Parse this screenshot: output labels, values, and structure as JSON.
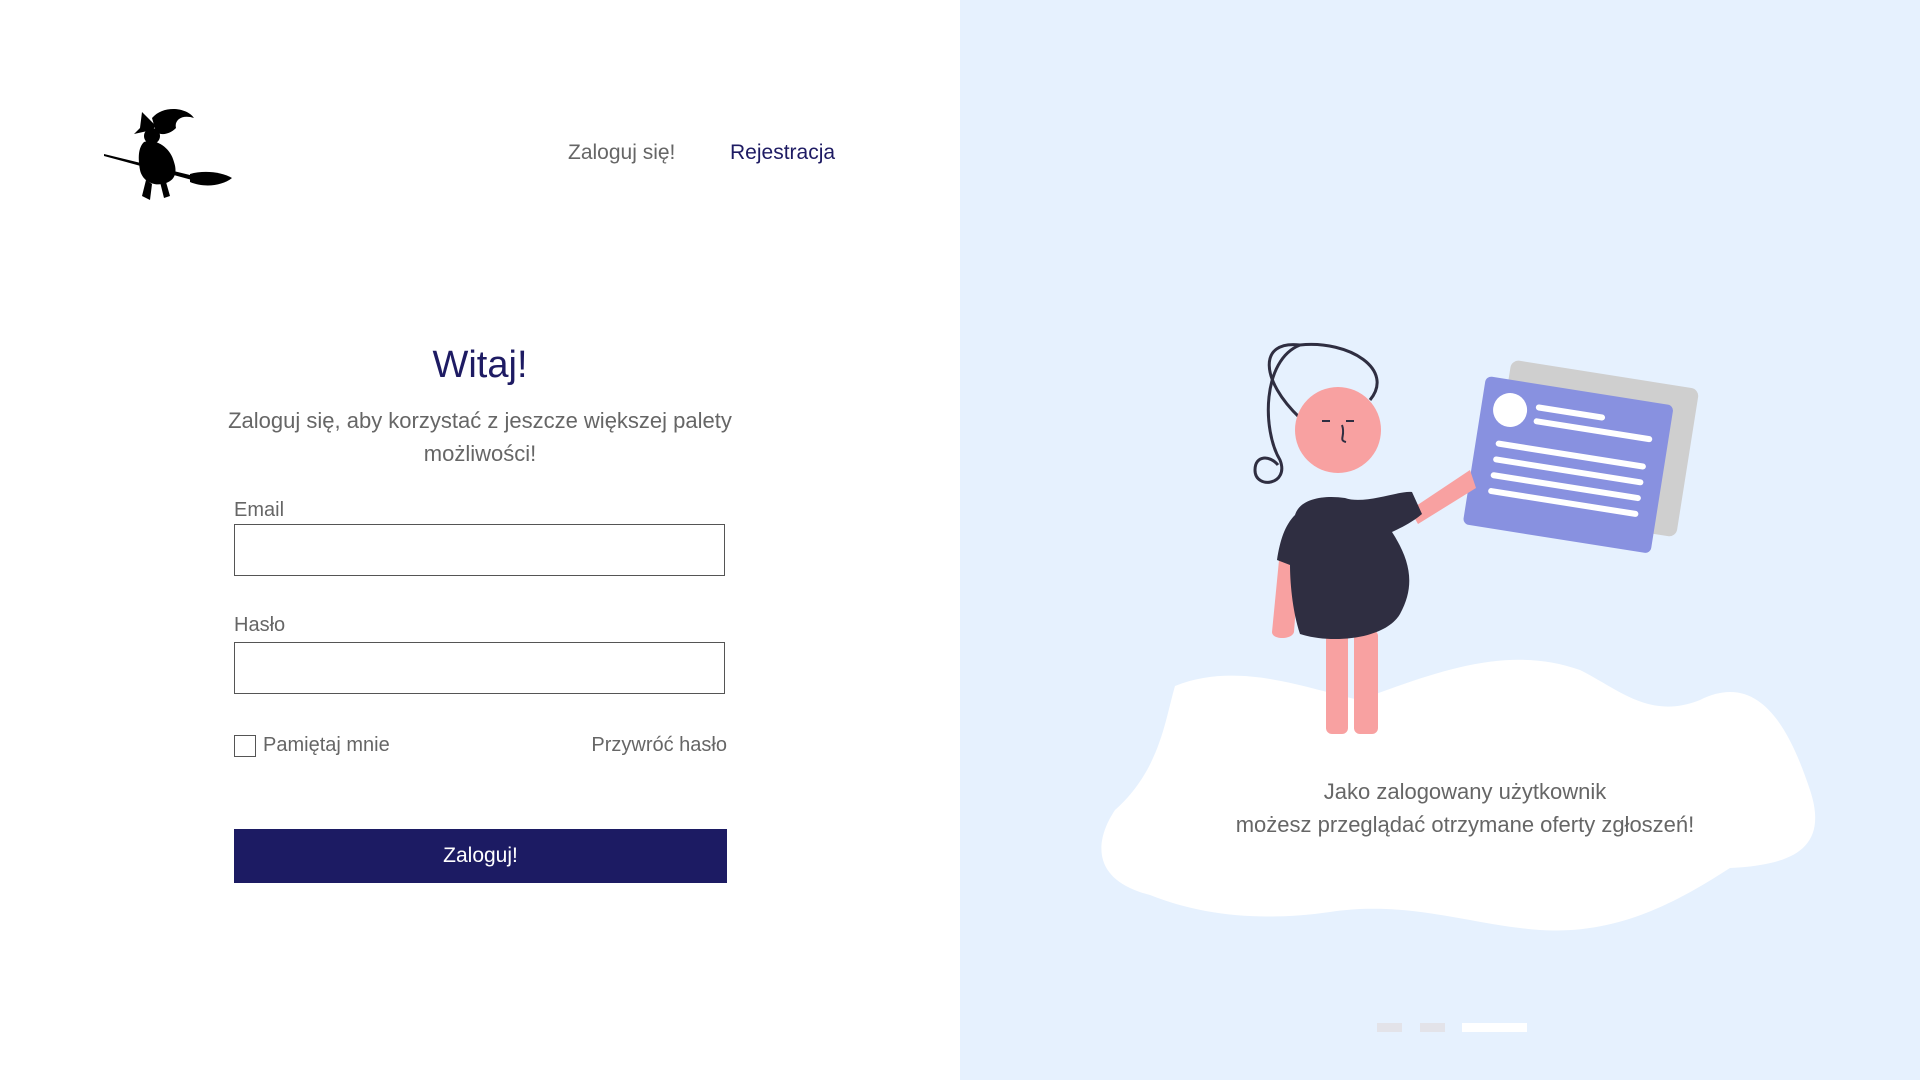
{
  "nav": {
    "login_label": "Zaloguj się!",
    "register_label": "Rejestracja"
  },
  "form": {
    "title": "Witaj!",
    "subtitle": "Zaloguj się, aby korzystać z jeszcze większej palety możliwości!",
    "email_label": "Email",
    "email_value": "",
    "password_label": "Hasło",
    "password_value": "",
    "remember_label": "Pamiętaj mnie",
    "remember_checked": false,
    "reset_label": "Przywróć hasło",
    "submit_label": "Zaloguj!"
  },
  "carousel": {
    "caption_line1": "Jako zalogowany użytkownik",
    "caption_line2": "możesz przeglądać otrzymane oferty zgłoszeń!",
    "slide_count": 3,
    "active_slide": 3
  },
  "colors": {
    "brand": "#1c1b63",
    "panel_bg": "#e6f1fe",
    "text_muted": "#666666",
    "card_purple": "#8891e0",
    "skin": "#f8a1a1",
    "dress": "#2f2e41"
  },
  "icons": {
    "logo": "witch-on-broom-logo"
  }
}
